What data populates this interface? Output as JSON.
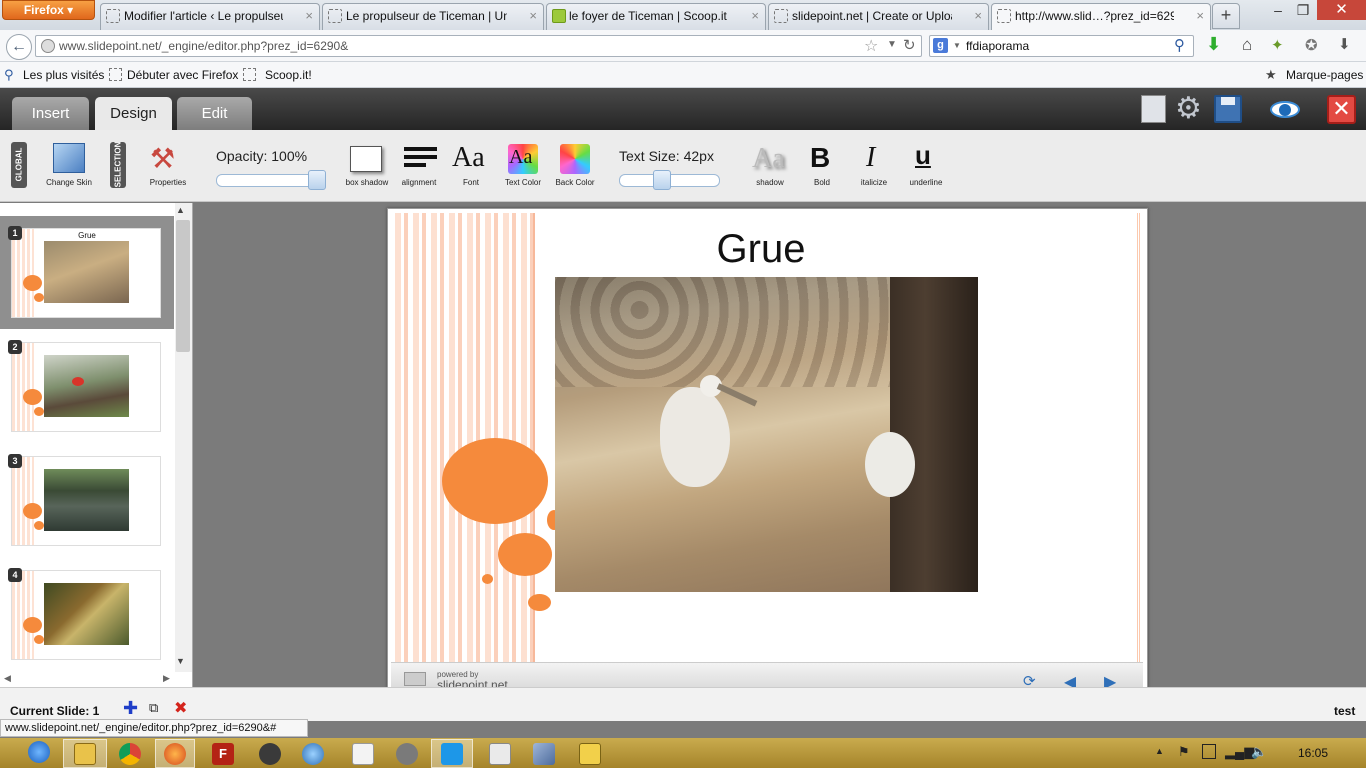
{
  "browser": {
    "menu_button": "Firefox",
    "tabs": [
      {
        "title": "Modifier l'article ‹ Le propulseur…"
      },
      {
        "title": "Le propulseur de Ticeman | Un s…"
      },
      {
        "title": "le foyer de Ticeman | Scoop.it"
      },
      {
        "title": "slidepoint.net | Create or Upload…"
      },
      {
        "title": "http://www.slid…?prez_id=6290&"
      }
    ],
    "new_tab": "+",
    "close_tab": "×",
    "url": "www.slidepoint.net/_engine/editor.php?prez_id=6290&",
    "search_value": "ffdiaporama",
    "bookmarks": [
      "Les plus visités",
      "Débuter avec Firefox",
      "Scoop.it!"
    ],
    "bookmarks_menu": "Marque-pages",
    "status_url": "www.slidepoint.net/_engine/editor.php?prez_id=6290&#"
  },
  "app": {
    "tabs": [
      "Insert",
      "Design",
      "Edit"
    ],
    "active_tab": "Design",
    "side_labels": [
      "GLOBAL",
      "SELECTION"
    ],
    "toolbar": {
      "change_skin": "Change Skin",
      "properties": "Properties",
      "opacity_label": "Opacity: 100%",
      "box_shadow": "box shadow",
      "alignment": "alignment",
      "font": "Font",
      "text_color": "Text Color",
      "back_color": "Back Color",
      "text_size_label": "Text Size: 42px",
      "shadow": "shadow",
      "bold": "Bold",
      "italicize": "italicize",
      "underline": "underline",
      "font_glyph": "Aa",
      "bold_glyph": "B",
      "italic_glyph": "I",
      "underline_glyph": "u"
    },
    "opacity_value": 100,
    "text_size_value": 42,
    "slides": [
      {
        "number": "1",
        "title": "Grue"
      },
      {
        "number": "2",
        "title": ""
      },
      {
        "number": "3",
        "title": ""
      },
      {
        "number": "4",
        "title": ""
      }
    ],
    "slide_title": "Grue",
    "footer": {
      "powered_by": "powered by",
      "brand": "slidepoint.net"
    },
    "current_slide_label": "Current Slide: 1",
    "presentation_name": "test"
  },
  "taskbar": {
    "clock": "16:05"
  },
  "colors": {
    "accent_orange": "#f58a3c",
    "firefox_orange": "#e8792c",
    "app_dark": "#2e2e2e"
  }
}
